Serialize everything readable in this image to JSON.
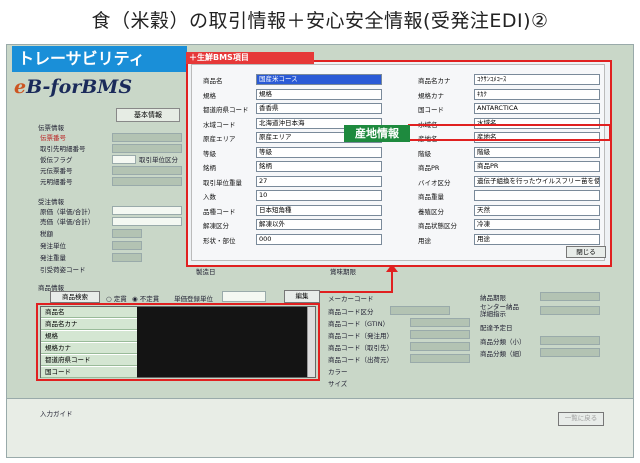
{
  "title": "食（米穀）の取引情報＋安心安全情報(受発注EDI)②",
  "brand": {
    "label": "トレーサビリティ",
    "logo": "eB-forBMS"
  },
  "tag_bms": "＋生鮮BMS項目",
  "tag_origin": "産地情報",
  "background": {
    "tab_basic": "基本情報",
    "section_tesei": "伝票情報",
    "labels_left": [
      "伝票番号",
      "取引先明細番号",
      "仮伝フラグ",
      "元伝票番号",
      "元明細番号"
    ],
    "label_tori": "取引単位区分",
    "section_order": "受注情報",
    "labels_order": [
      "原価（単価/合計）",
      "売価（単価/合計）",
      "税額",
      "発注単位",
      "発注重量",
      "引受荷姿コード"
    ],
    "under_left": "製造日",
    "under_mid": "賞味期限",
    "product_section": "商品情報",
    "product_search": "商品検索",
    "radio_fixed": "定貫",
    "radio_unfixed": "不定貫",
    "unit_register": "単価登録単位",
    "edit": "編集",
    "product_rows": [
      "商品名",
      "商品名カナ",
      "規格",
      "規格カナ",
      "都道府県コード",
      "国コード"
    ],
    "right_labels": [
      "メーカーコード",
      "商品コード区分",
      "商品コード（GTIN）",
      "商品コード（発注用）",
      "商品コード（取引先）",
      "商品コード（出荷元）",
      "カラー",
      "サイズ"
    ],
    "far_labels": [
      "納品期限",
      "センター納品\n詳細指示",
      "配達予定日",
      "商品分類（小）",
      "商品分類（細）"
    ],
    "input_guide": "入力ガイド",
    "back": "一覧に戻る"
  },
  "dialog": {
    "left": [
      {
        "label": "商品名",
        "value": "国産米コース",
        "selected": true
      },
      {
        "label": "規格",
        "value": "規格"
      },
      {
        "label": "都道府県コード",
        "value": "香香県"
      },
      {
        "label": "水域コード",
        "value": "北海道沖日本海"
      },
      {
        "label": "原産エリア",
        "value": "原産エリア"
      },
      {
        "label": "等級",
        "value": "等級"
      },
      {
        "label": "銘柄",
        "value": "銘柄"
      },
      {
        "label": "取引単位重量",
        "value": "27"
      },
      {
        "label": "入数",
        "value": "10"
      },
      {
        "label": "品種コード",
        "value": "日本短角種"
      },
      {
        "label": "解凍区分",
        "value": "解凍以外"
      },
      {
        "label": "形状・部位",
        "value": "000"
      }
    ],
    "right": [
      {
        "label": "商品名カナ",
        "value": "ｺｸｻﾝｺﾒｺｰｽ"
      },
      {
        "label": "規格カナ",
        "value": "ｷｶｸ"
      },
      {
        "label": "国コード",
        "value": "ANTARCTICA"
      },
      {
        "label": "水域名",
        "value": "水域名"
      },
      {
        "label": "産地名",
        "value": "産地名"
      },
      {
        "label": "階級",
        "value": "階級"
      },
      {
        "label": "商品PR",
        "value": "商品PR"
      },
      {
        "label": "バイオ区分",
        "value": "遺伝子組換を行ったウイルスフリー苗を使用"
      },
      {
        "label": "商品重量",
        "value": ""
      },
      {
        "label": "養殖区分",
        "value": "天然"
      },
      {
        "label": "商品状態区分",
        "value": "冷凍"
      },
      {
        "label": "用途",
        "value": "用途"
      }
    ],
    "close": "閉じる"
  }
}
